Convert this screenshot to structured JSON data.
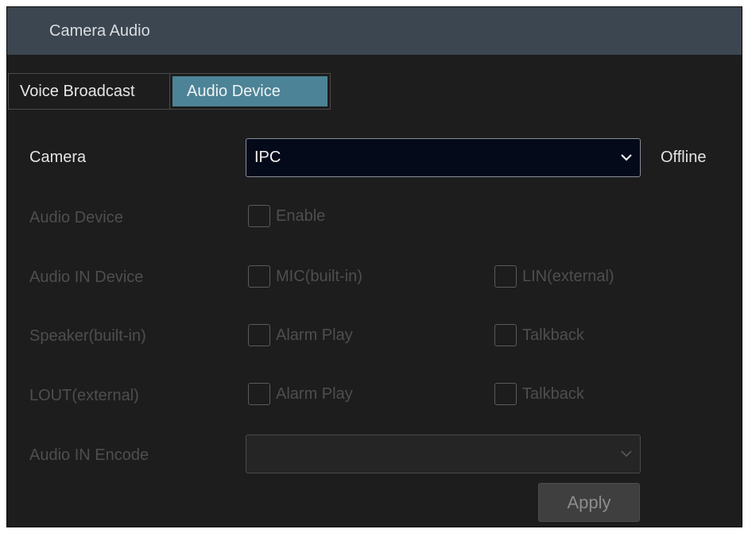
{
  "window": {
    "title": "Camera Audio"
  },
  "tabs": [
    {
      "label": "Voice Broadcast",
      "active": false
    },
    {
      "label": "Audio Device",
      "active": true
    }
  ],
  "form": {
    "camera": {
      "label": "Camera",
      "value": "IPC",
      "status": "Offline"
    },
    "audio_device": {
      "label": "Audio Device",
      "option": "Enable",
      "checked": false
    },
    "audio_in_device": {
      "label": "Audio IN Device",
      "options": [
        "MIC(built-in)",
        "LIN(external)"
      ]
    },
    "speaker": {
      "label": "Speaker(built-in)",
      "options": [
        "Alarm Play",
        "Talkback"
      ]
    },
    "lout": {
      "label": "LOUT(external)",
      "options": [
        "Alarm Play",
        "Talkback"
      ]
    },
    "audio_in_encode": {
      "label": "Audio IN Encode",
      "value": ""
    }
  },
  "actions": {
    "apply": "Apply"
  },
  "colors": {
    "background": "#1d1d1d",
    "titlebar": "#3c4650",
    "active_tab": "#4d8396",
    "select_bg": "#050a1a"
  }
}
